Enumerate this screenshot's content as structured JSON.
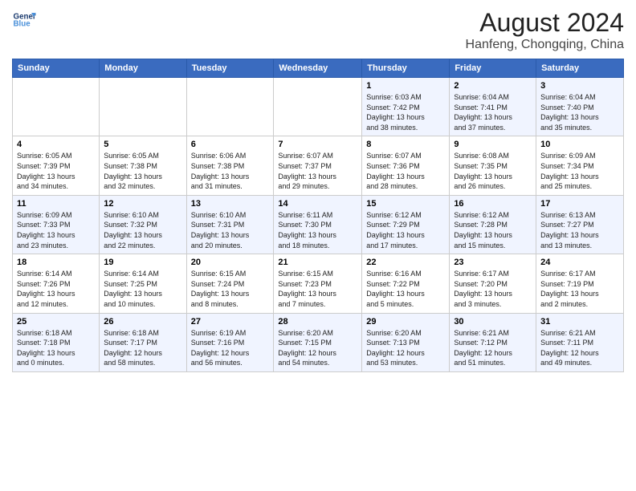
{
  "header": {
    "logo_line1": "General",
    "logo_line2": "Blue",
    "month_year": "August 2024",
    "location": "Hanfeng, Chongqing, China"
  },
  "weekdays": [
    "Sunday",
    "Monday",
    "Tuesday",
    "Wednesday",
    "Thursday",
    "Friday",
    "Saturday"
  ],
  "weeks": [
    [
      {
        "day": "",
        "info": ""
      },
      {
        "day": "",
        "info": ""
      },
      {
        "day": "",
        "info": ""
      },
      {
        "day": "",
        "info": ""
      },
      {
        "day": "1",
        "info": "Sunrise: 6:03 AM\nSunset: 7:42 PM\nDaylight: 13 hours\nand 38 minutes."
      },
      {
        "day": "2",
        "info": "Sunrise: 6:04 AM\nSunset: 7:41 PM\nDaylight: 13 hours\nand 37 minutes."
      },
      {
        "day": "3",
        "info": "Sunrise: 6:04 AM\nSunset: 7:40 PM\nDaylight: 13 hours\nand 35 minutes."
      }
    ],
    [
      {
        "day": "4",
        "info": "Sunrise: 6:05 AM\nSunset: 7:39 PM\nDaylight: 13 hours\nand 34 minutes."
      },
      {
        "day": "5",
        "info": "Sunrise: 6:05 AM\nSunset: 7:38 PM\nDaylight: 13 hours\nand 32 minutes."
      },
      {
        "day": "6",
        "info": "Sunrise: 6:06 AM\nSunset: 7:38 PM\nDaylight: 13 hours\nand 31 minutes."
      },
      {
        "day": "7",
        "info": "Sunrise: 6:07 AM\nSunset: 7:37 PM\nDaylight: 13 hours\nand 29 minutes."
      },
      {
        "day": "8",
        "info": "Sunrise: 6:07 AM\nSunset: 7:36 PM\nDaylight: 13 hours\nand 28 minutes."
      },
      {
        "day": "9",
        "info": "Sunrise: 6:08 AM\nSunset: 7:35 PM\nDaylight: 13 hours\nand 26 minutes."
      },
      {
        "day": "10",
        "info": "Sunrise: 6:09 AM\nSunset: 7:34 PM\nDaylight: 13 hours\nand 25 minutes."
      }
    ],
    [
      {
        "day": "11",
        "info": "Sunrise: 6:09 AM\nSunset: 7:33 PM\nDaylight: 13 hours\nand 23 minutes."
      },
      {
        "day": "12",
        "info": "Sunrise: 6:10 AM\nSunset: 7:32 PM\nDaylight: 13 hours\nand 22 minutes."
      },
      {
        "day": "13",
        "info": "Sunrise: 6:10 AM\nSunset: 7:31 PM\nDaylight: 13 hours\nand 20 minutes."
      },
      {
        "day": "14",
        "info": "Sunrise: 6:11 AM\nSunset: 7:30 PM\nDaylight: 13 hours\nand 18 minutes."
      },
      {
        "day": "15",
        "info": "Sunrise: 6:12 AM\nSunset: 7:29 PM\nDaylight: 13 hours\nand 17 minutes."
      },
      {
        "day": "16",
        "info": "Sunrise: 6:12 AM\nSunset: 7:28 PM\nDaylight: 13 hours\nand 15 minutes."
      },
      {
        "day": "17",
        "info": "Sunrise: 6:13 AM\nSunset: 7:27 PM\nDaylight: 13 hours\nand 13 minutes."
      }
    ],
    [
      {
        "day": "18",
        "info": "Sunrise: 6:14 AM\nSunset: 7:26 PM\nDaylight: 13 hours\nand 12 minutes."
      },
      {
        "day": "19",
        "info": "Sunrise: 6:14 AM\nSunset: 7:25 PM\nDaylight: 13 hours\nand 10 minutes."
      },
      {
        "day": "20",
        "info": "Sunrise: 6:15 AM\nSunset: 7:24 PM\nDaylight: 13 hours\nand 8 minutes."
      },
      {
        "day": "21",
        "info": "Sunrise: 6:15 AM\nSunset: 7:23 PM\nDaylight: 13 hours\nand 7 minutes."
      },
      {
        "day": "22",
        "info": "Sunrise: 6:16 AM\nSunset: 7:22 PM\nDaylight: 13 hours\nand 5 minutes."
      },
      {
        "day": "23",
        "info": "Sunrise: 6:17 AM\nSunset: 7:20 PM\nDaylight: 13 hours\nand 3 minutes."
      },
      {
        "day": "24",
        "info": "Sunrise: 6:17 AM\nSunset: 7:19 PM\nDaylight: 13 hours\nand 2 minutes."
      }
    ],
    [
      {
        "day": "25",
        "info": "Sunrise: 6:18 AM\nSunset: 7:18 PM\nDaylight: 13 hours\nand 0 minutes."
      },
      {
        "day": "26",
        "info": "Sunrise: 6:18 AM\nSunset: 7:17 PM\nDaylight: 12 hours\nand 58 minutes."
      },
      {
        "day": "27",
        "info": "Sunrise: 6:19 AM\nSunset: 7:16 PM\nDaylight: 12 hours\nand 56 minutes."
      },
      {
        "day": "28",
        "info": "Sunrise: 6:20 AM\nSunset: 7:15 PM\nDaylight: 12 hours\nand 54 minutes."
      },
      {
        "day": "29",
        "info": "Sunrise: 6:20 AM\nSunset: 7:13 PM\nDaylight: 12 hours\nand 53 minutes."
      },
      {
        "day": "30",
        "info": "Sunrise: 6:21 AM\nSunset: 7:12 PM\nDaylight: 12 hours\nand 51 minutes."
      },
      {
        "day": "31",
        "info": "Sunrise: 6:21 AM\nSunset: 7:11 PM\nDaylight: 12 hours\nand 49 minutes."
      }
    ]
  ]
}
